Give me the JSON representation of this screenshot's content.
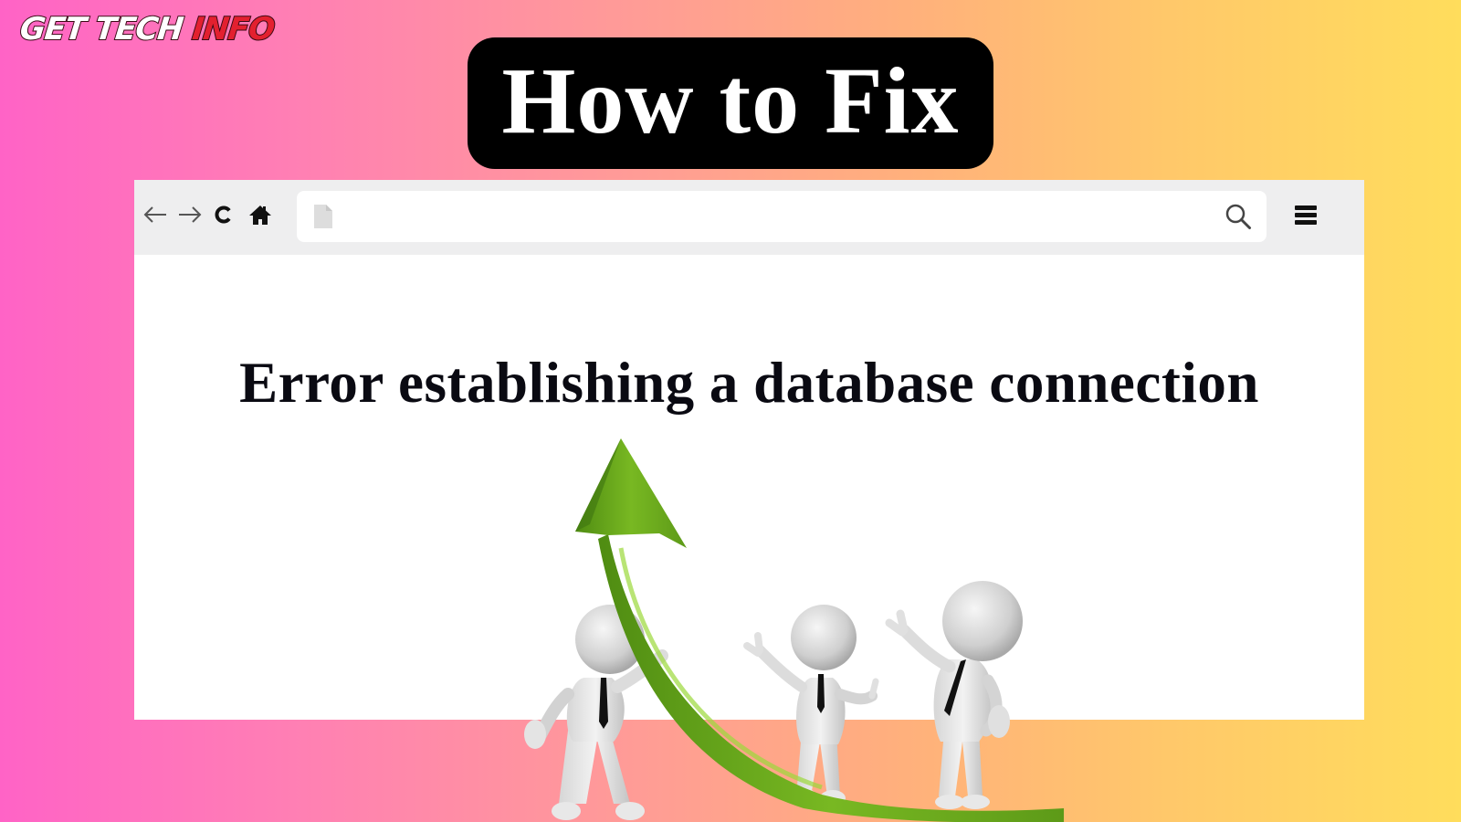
{
  "brand": {
    "part1": "GET TECH ",
    "part2": "INFO"
  },
  "title": {
    "text": "How to Fix"
  },
  "browser": {
    "toolbar": {
      "back_icon": "arrow-left-icon",
      "forward_icon": "arrow-right-icon",
      "reload_icon": "reload-icon",
      "home_icon": "home-icon",
      "page_icon": "blank-page-icon",
      "search_icon": "search-icon",
      "menu_icon": "hamburger-menu-icon",
      "address_value": ""
    },
    "error_message": "Error establishing a database connection"
  },
  "illustration": {
    "description": "Three white 3D figures with black ties beside a rising green arrow",
    "colors": {
      "arrow": "#6aaa1e",
      "arrow_highlight": "#8ccc2c",
      "figure": "#e6e6e6",
      "tie": "#111111"
    }
  },
  "colors": {
    "gradient_left": "#ff63c6",
    "gradient_mid": "#ff9a98",
    "gradient_right": "#ffdd5c",
    "brand_red": "#e3202f",
    "toolbar_bg": "#eeeeef"
  }
}
